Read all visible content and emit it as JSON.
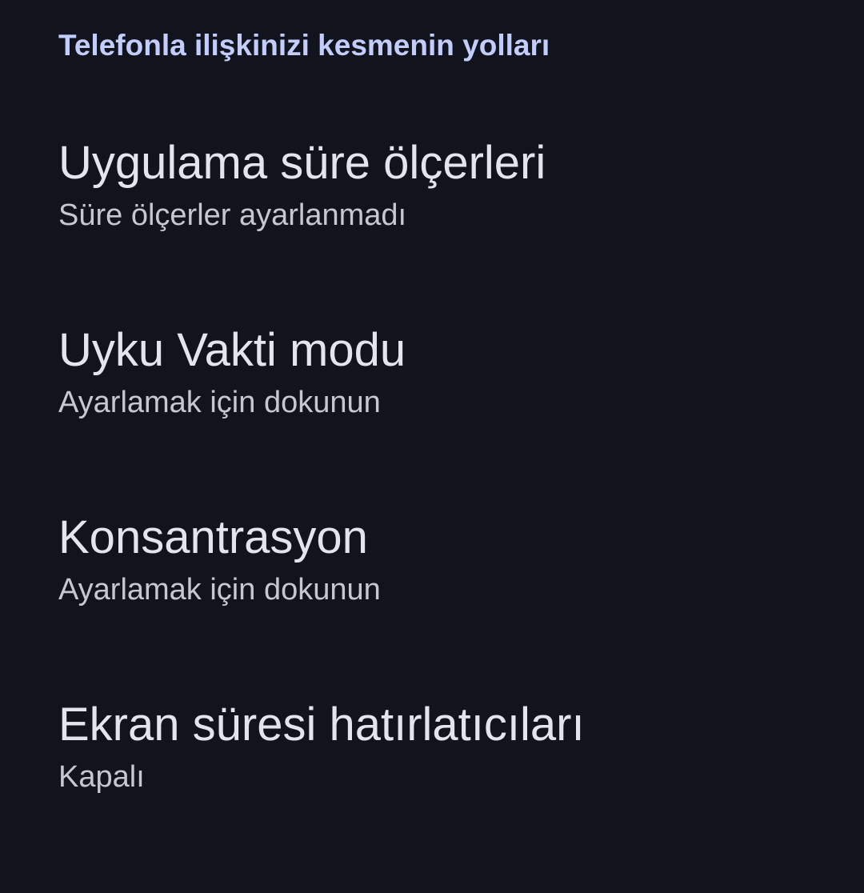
{
  "section": {
    "header": "Telefonla ilişkinizi kesmenin yolları"
  },
  "items": [
    {
      "title": "Uygulama süre ölçerleri",
      "summary": "Süre ölçerler ayarlanmadı"
    },
    {
      "title": "Uyku Vakti modu",
      "summary": "Ayarlamak için dokunun"
    },
    {
      "title": "Konsantrasyon",
      "summary": "Ayarlamak için dokunun"
    },
    {
      "title": "Ekran süresi hatırlatıcıları",
      "summary": "Kapalı"
    }
  ],
  "colors": {
    "background": "#12141d",
    "header": "#c3cdfb",
    "title": "#e3e4ee",
    "summary": "#c6c7d1"
  }
}
